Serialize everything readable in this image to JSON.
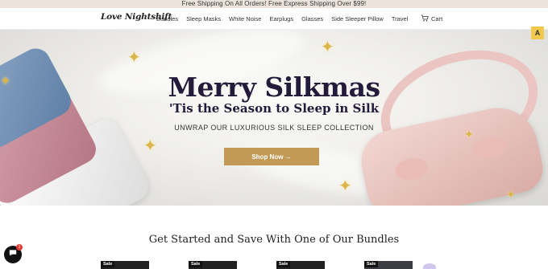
{
  "announcement": "Free Shipping On All Orders! Free Express Shipping Over $99!",
  "header": {
    "logo": "Love Nightshift",
    "nav": [
      "Bundles",
      "Sleep Masks",
      "White Noise",
      "Earplugs",
      "Glasses",
      "Side Sleeper Pillow",
      "Travel"
    ],
    "cart_label": "Cart"
  },
  "hero": {
    "title": "Merry Silkmas",
    "subtitle": "'Tis the Season to Sleep in Silk",
    "tagline": "UNWRAP OUR LUXURIOUS SILK SLEEP COLLECTION",
    "cta_label": "Shop Now →"
  },
  "scroll_button": "A",
  "section": {
    "title": "Get Started and Save With One of Our Bundles",
    "bundles": [
      {
        "badge": "Sale"
      },
      {
        "badge": "Sale"
      },
      {
        "badge": "Sale"
      },
      {
        "badge": "Sale"
      }
    ]
  },
  "chat": {
    "badge_count": "1"
  },
  "colors": {
    "announcement_bg": "#ece4dc",
    "cta_bg": "#c29a55",
    "title_color": "#231b3a",
    "scroll_btn": "#f2c94c"
  }
}
